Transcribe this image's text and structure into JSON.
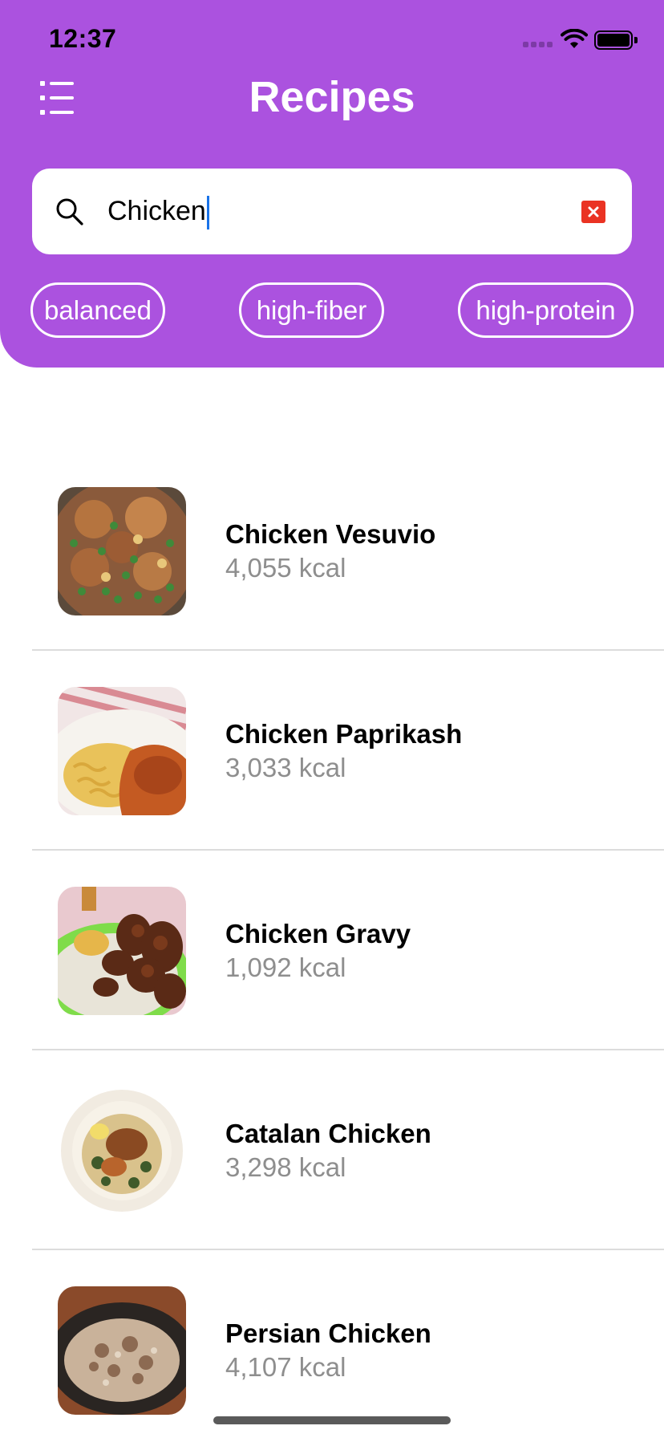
{
  "status_bar": {
    "time": "12:37"
  },
  "header": {
    "title": "Recipes"
  },
  "search": {
    "value": "Chicken"
  },
  "filters": [
    "balanced",
    "high-fiber",
    "high-protein"
  ],
  "recipes": [
    {
      "name": "Chicken Vesuvio",
      "calories": "4,055 kcal"
    },
    {
      "name": "Chicken Paprikash",
      "calories": "3,033 kcal"
    },
    {
      "name": "Chicken Gravy",
      "calories": "1,092 kcal"
    },
    {
      "name": "Catalan Chicken",
      "calories": "3,298 kcal"
    },
    {
      "name": "Persian Chicken",
      "calories": "4,107 kcal"
    }
  ],
  "colors": {
    "accent": "#ab52df",
    "clear_button": "#ea3323",
    "caret": "#1a73e8",
    "secondary_text": "#8e8e8e"
  },
  "icons": {
    "menu": "list-icon",
    "search": "magnifier-icon",
    "clear": "close-icon"
  }
}
